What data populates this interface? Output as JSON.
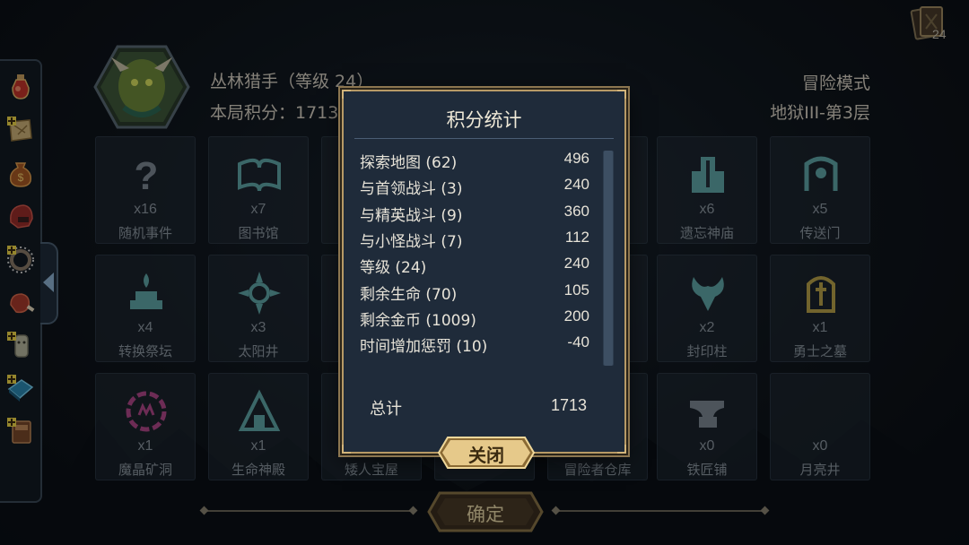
{
  "top": {
    "deck_count": "24"
  },
  "hero": {
    "name_level": "丛林猎手（等级 24）",
    "run_score": "本局积分：1713"
  },
  "mode": {
    "title": "冒险模式",
    "floor": "地狱III-第3层"
  },
  "tiles": [
    {
      "icon": "question-mark-icon",
      "count": "x16",
      "name": "随机事件",
      "color": "#7c8894"
    },
    {
      "icon": "open-book-icon",
      "count": "x7",
      "name": "图书馆",
      "color": "#5fa6a8"
    },
    {
      "icon": "",
      "count": "",
      "name": "",
      "color": "#5a6470"
    },
    {
      "icon": "",
      "count": "",
      "name": "",
      "color": "#5a6470"
    },
    {
      "icon": "",
      "count": "",
      "name": "",
      "color": "#5a6470"
    },
    {
      "icon": "forgotten-temple-icon",
      "count": "x6",
      "name": "遗忘神庙",
      "color": "#5fa6a8"
    },
    {
      "icon": "portal-icon",
      "count": "x5",
      "name": "传送门",
      "color": "#5fa6a8"
    },
    {
      "icon": "altar-icon",
      "count": "x4",
      "name": "转换祭坛",
      "color": "#5fa6a8"
    },
    {
      "icon": "sun-well-icon",
      "count": "x3",
      "name": "太阳井",
      "color": "#5fa6a8"
    },
    {
      "icon": "",
      "count": "",
      "name": "",
      "color": "#5a6470"
    },
    {
      "icon": "",
      "count": "",
      "name": "",
      "color": "#5a6470"
    },
    {
      "icon": "",
      "count": "",
      "name": "",
      "color": "#5a6470"
    },
    {
      "icon": "seal-pillar-icon",
      "count": "x2",
      "name": "封印柱",
      "color": "#5fa6a8"
    },
    {
      "icon": "warrior-tomb-icon",
      "count": "x1",
      "name": "勇士之墓",
      "color": "#b8a24a"
    },
    {
      "icon": "crystal-mine-icon",
      "count": "x1",
      "name": "魔晶矿洞",
      "color": "#b0488a"
    },
    {
      "icon": "life-shrine-icon",
      "count": "x1",
      "name": "生命神殿",
      "color": "#5fa6a8"
    },
    {
      "icon": "",
      "count": "",
      "name": "矮人宝屋",
      "color": "#5a6470"
    },
    {
      "icon": "",
      "count": "",
      "name": "",
      "color": "#5a6470"
    },
    {
      "icon": "",
      "count": "",
      "name": "冒险者仓库",
      "color": "#5a6470"
    },
    {
      "icon": "anvil-icon",
      "count": "x0",
      "name": "铁匠铺",
      "color": "#7c8894"
    },
    {
      "icon": "moon-well-icon",
      "count": "x0",
      "name": "月亮井",
      "color": "#7c8894"
    }
  ],
  "modal": {
    "title": "积分统计",
    "rows": [
      {
        "label": "探索地图 (62)",
        "value": "496"
      },
      {
        "label": "与首领战斗 (3)",
        "value": "240"
      },
      {
        "label": "与精英战斗 (9)",
        "value": "360"
      },
      {
        "label": "与小怪战斗 (7)",
        "value": "112"
      },
      {
        "label": "等级 (24)",
        "value": "240"
      },
      {
        "label": "剩余生命 (70)",
        "value": "105"
      },
      {
        "label": "剩余金币 (1009)",
        "value": "200"
      },
      {
        "label": "时间增加惩罚 (10)",
        "value": "-40"
      }
    ],
    "total_label": "总计",
    "total_value": "1713",
    "close_label": "关闭"
  },
  "confirm_label": "确定",
  "items": [
    "red-potion-icon",
    "map-scroll-icon",
    "gold-pouch-icon",
    "red-helmet-icon",
    "spiked-ring-icon",
    "meat-icon",
    "stone-idol-icon",
    "blue-tome-icon",
    "brown-tome-icon"
  ],
  "colors": {
    "panel": "#1f2b3a",
    "panel_border": "#b79a66",
    "button_gold": "#e6c98a",
    "text_light": "#e7e3d8"
  }
}
